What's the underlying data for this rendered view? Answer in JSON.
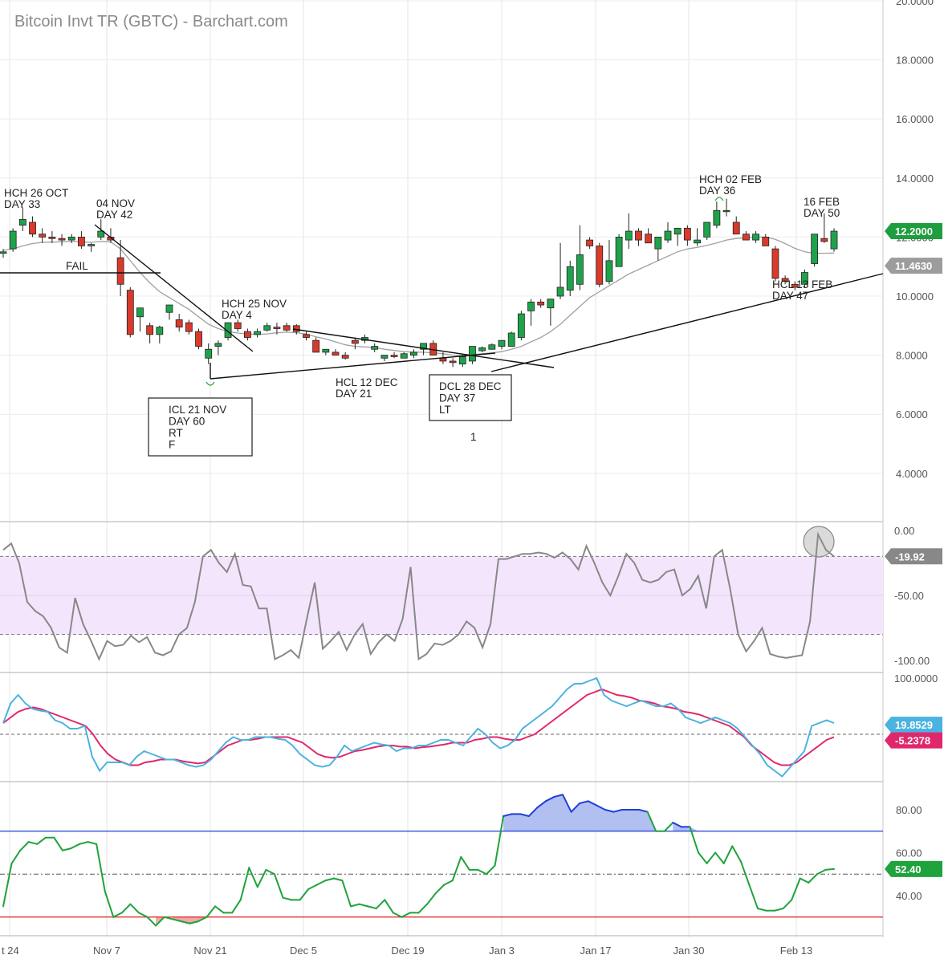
{
  "title": "Bitcoin Invt TR (GBTC) - Barchart.com",
  "chart_data": [
    {
      "type": "candlestick",
      "title": "Bitcoin Invt TR (GBTC) - Barchart.com",
      "x_tick_labels": [
        "t 24",
        "Nov 7",
        "Nov 21",
        "Dec 5",
        "Dec 19",
        "Jan 3",
        "Jan 17",
        "Jan 30",
        "Feb 13"
      ],
      "y_ticks": [
        "4.0000",
        "6.0000",
        "8.0000",
        "10.0000",
        "12.0000",
        "14.0000",
        "16.0000",
        "18.0000",
        "20.0000"
      ],
      "ylim": [
        2.5,
        20
      ],
      "last_price_label": "12.2000",
      "ma_label": "11.4630",
      "colors": {
        "up": "#1fa34a",
        "down": "#d93a2b",
        "ma": "#a0a0a0",
        "last_badge": "#1e9e3e",
        "ma_badge": "#9c9c9c"
      },
      "candles": [
        {
          "o": 11.45,
          "h": 11.6,
          "l": 11.3,
          "c": 11.5
        },
        {
          "o": 11.6,
          "h": 12.3,
          "l": 11.5,
          "c": 12.2
        },
        {
          "o": 12.4,
          "h": 13.0,
          "l": 12.2,
          "c": 12.6
        },
        {
          "o": 12.5,
          "h": 12.7,
          "l": 12.0,
          "c": 12.1
        },
        {
          "o": 12.1,
          "h": 12.3,
          "l": 11.8,
          "c": 12.0
        },
        {
          "o": 12.0,
          "h": 12.2,
          "l": 11.8,
          "c": 11.95
        },
        {
          "o": 11.95,
          "h": 12.1,
          "l": 11.7,
          "c": 11.9
        },
        {
          "o": 11.9,
          "h": 12.1,
          "l": 11.8,
          "c": 12.0
        },
        {
          "o": 12.0,
          "h": 12.2,
          "l": 11.6,
          "c": 11.7
        },
        {
          "o": 11.7,
          "h": 11.8,
          "l": 11.5,
          "c": 11.75
        },
        {
          "o": 12.0,
          "h": 12.6,
          "l": 11.9,
          "c": 12.2
        },
        {
          "o": 12.0,
          "h": 12.3,
          "l": 11.8,
          "c": 11.9
        },
        {
          "o": 11.3,
          "h": 11.9,
          "l": 10.0,
          "c": 10.4
        },
        {
          "o": 10.2,
          "h": 10.3,
          "l": 8.6,
          "c": 8.7
        },
        {
          "o": 9.3,
          "h": 9.6,
          "l": 8.8,
          "c": 9.6
        },
        {
          "o": 9.0,
          "h": 9.1,
          "l": 8.4,
          "c": 8.7
        },
        {
          "o": 8.7,
          "h": 9.0,
          "l": 8.4,
          "c": 8.95
        },
        {
          "o": 9.45,
          "h": 9.7,
          "l": 9.2,
          "c": 9.7
        },
        {
          "o": 9.2,
          "h": 9.4,
          "l": 8.8,
          "c": 8.95
        },
        {
          "o": 9.1,
          "h": 9.2,
          "l": 8.7,
          "c": 8.8
        },
        {
          "o": 8.8,
          "h": 8.9,
          "l": 8.2,
          "c": 8.3
        },
        {
          "o": 7.9,
          "h": 8.4,
          "l": 7.7,
          "c": 8.2
        },
        {
          "o": 8.3,
          "h": 8.5,
          "l": 8.0,
          "c": 8.4
        },
        {
          "o": 8.6,
          "h": 9.1,
          "l": 8.5,
          "c": 9.1
        },
        {
          "o": 9.1,
          "h": 9.2,
          "l": 8.8,
          "c": 8.9
        },
        {
          "o": 8.8,
          "h": 8.9,
          "l": 8.5,
          "c": 8.6
        },
        {
          "o": 8.7,
          "h": 8.9,
          "l": 8.6,
          "c": 8.8
        },
        {
          "o": 8.85,
          "h": 9.1,
          "l": 8.8,
          "c": 9.0
        },
        {
          "o": 8.95,
          "h": 9.1,
          "l": 8.7,
          "c": 8.9
        },
        {
          "o": 9.0,
          "h": 9.1,
          "l": 8.8,
          "c": 8.85
        },
        {
          "o": 9.0,
          "h": 9.05,
          "l": 8.7,
          "c": 8.8
        },
        {
          "o": 8.7,
          "h": 8.8,
          "l": 8.5,
          "c": 8.6
        },
        {
          "o": 8.5,
          "h": 8.6,
          "l": 8.1,
          "c": 8.1
        },
        {
          "o": 8.1,
          "h": 8.2,
          "l": 8.0,
          "c": 8.2
        },
        {
          "o": 8.1,
          "h": 8.2,
          "l": 8.0,
          "c": 8.0
        },
        {
          "o": 8.0,
          "h": 8.1,
          "l": 7.85,
          "c": 7.9
        },
        {
          "o": 8.5,
          "h": 8.6,
          "l": 8.2,
          "c": 8.4
        },
        {
          "o": 8.5,
          "h": 8.7,
          "l": 8.4,
          "c": 8.6
        },
        {
          "o": 8.2,
          "h": 8.4,
          "l": 8.1,
          "c": 8.3
        },
        {
          "o": 7.9,
          "h": 8.0,
          "l": 7.8,
          "c": 8.0
        },
        {
          "o": 8.0,
          "h": 8.1,
          "l": 7.9,
          "c": 7.95
        },
        {
          "o": 7.9,
          "h": 8.1,
          "l": 7.9,
          "c": 8.05
        },
        {
          "o": 8.0,
          "h": 8.2,
          "l": 7.9,
          "c": 8.1
        },
        {
          "o": 8.2,
          "h": 8.4,
          "l": 8.0,
          "c": 8.4
        },
        {
          "o": 8.4,
          "h": 8.5,
          "l": 8.0,
          "c": 8.0
        },
        {
          "o": 7.9,
          "h": 8.1,
          "l": 7.7,
          "c": 7.8
        },
        {
          "o": 7.8,
          "h": 7.9,
          "l": 7.6,
          "c": 7.75
        },
        {
          "o": 7.7,
          "h": 8.0,
          "l": 7.6,
          "c": 7.95
        },
        {
          "o": 7.8,
          "h": 8.3,
          "l": 7.7,
          "c": 8.3
        },
        {
          "o": 8.15,
          "h": 8.3,
          "l": 8.1,
          "c": 8.25
        },
        {
          "o": 8.2,
          "h": 8.4,
          "l": 8.2,
          "c": 8.35
        },
        {
          "o": 8.3,
          "h": 8.5,
          "l": 8.2,
          "c": 8.5
        },
        {
          "o": 8.3,
          "h": 8.8,
          "l": 8.3,
          "c": 8.75
        },
        {
          "o": 8.6,
          "h": 9.5,
          "l": 8.5,
          "c": 9.4
        },
        {
          "o": 9.5,
          "h": 9.9,
          "l": 9.0,
          "c": 9.8
        },
        {
          "o": 9.8,
          "h": 9.9,
          "l": 9.6,
          "c": 9.7
        },
        {
          "o": 9.6,
          "h": 9.9,
          "l": 9.0,
          "c": 9.9
        },
        {
          "o": 10.0,
          "h": 11.8,
          "l": 9.9,
          "c": 10.3
        },
        {
          "o": 10.2,
          "h": 11.2,
          "l": 10.0,
          "c": 11.0
        },
        {
          "o": 10.4,
          "h": 12.4,
          "l": 10.2,
          "c": 11.4
        },
        {
          "o": 11.9,
          "h": 12.0,
          "l": 11.6,
          "c": 11.7
        },
        {
          "o": 11.7,
          "h": 11.8,
          "l": 10.3,
          "c": 10.4
        },
        {
          "o": 10.5,
          "h": 11.9,
          "l": 10.4,
          "c": 11.2
        },
        {
          "o": 11.0,
          "h": 12.1,
          "l": 11.0,
          "c": 12.0
        },
        {
          "o": 11.9,
          "h": 12.8,
          "l": 11.6,
          "c": 12.2
        },
        {
          "o": 12.2,
          "h": 12.3,
          "l": 11.7,
          "c": 11.9
        },
        {
          "o": 12.1,
          "h": 12.3,
          "l": 11.8,
          "c": 11.8
        },
        {
          "o": 11.6,
          "h": 12.0,
          "l": 11.2,
          "c": 12.0
        },
        {
          "o": 11.9,
          "h": 12.5,
          "l": 11.8,
          "c": 12.2
        },
        {
          "o": 12.1,
          "h": 12.3,
          "l": 11.7,
          "c": 12.3
        },
        {
          "o": 12.3,
          "h": 12.4,
          "l": 11.7,
          "c": 11.9
        },
        {
          "o": 11.8,
          "h": 12.3,
          "l": 11.7,
          "c": 11.9
        },
        {
          "o": 12.0,
          "h": 12.5,
          "l": 11.9,
          "c": 12.5
        },
        {
          "o": 12.4,
          "h": 13.2,
          "l": 12.3,
          "c": 12.9
        },
        {
          "o": 12.9,
          "h": 13.3,
          "l": 12.7,
          "c": 12.9
        },
        {
          "o": 12.5,
          "h": 12.7,
          "l": 12.1,
          "c": 12.1
        },
        {
          "o": 12.1,
          "h": 12.2,
          "l": 11.9,
          "c": 11.9
        },
        {
          "o": 11.9,
          "h": 12.2,
          "l": 11.8,
          "c": 12.1
        },
        {
          "o": 12.0,
          "h": 12.1,
          "l": 11.7,
          "c": 11.7
        },
        {
          "o": 11.6,
          "h": 11.7,
          "l": 10.5,
          "c": 10.6
        },
        {
          "o": 10.6,
          "h": 10.7,
          "l": 10.4,
          "c": 10.5
        },
        {
          "o": 10.4,
          "h": 10.5,
          "l": 10.2,
          "c": 10.3
        },
        {
          "o": 10.4,
          "h": 10.9,
          "l": 10.3,
          "c": 10.8
        },
        {
          "o": 11.1,
          "h": 12.1,
          "l": 11.0,
          "c": 12.1
        },
        {
          "o": 11.95,
          "h": 12.8,
          "l": 11.8,
          "c": 11.85
        },
        {
          "o": 11.6,
          "h": 12.3,
          "l": 11.5,
          "c": 12.2
        }
      ],
      "ma": [
        11.55,
        11.6,
        11.7,
        11.78,
        11.82,
        11.83,
        11.84,
        11.85,
        11.84,
        11.82,
        11.85,
        11.84,
        11.6,
        11.2,
        10.8,
        10.45,
        10.15,
        9.95,
        9.75,
        9.55,
        9.3,
        9.05,
        8.9,
        8.8,
        8.75,
        8.72,
        8.7,
        8.72,
        8.76,
        8.78,
        8.76,
        8.72,
        8.62,
        8.55,
        8.45,
        8.35,
        8.3,
        8.28,
        8.26,
        8.2,
        8.16,
        8.12,
        8.1,
        8.1,
        8.08,
        8.05,
        8.0,
        8.0,
        8.02,
        8.05,
        8.08,
        8.12,
        8.2,
        8.3,
        8.45,
        8.6,
        8.8,
        9.05,
        9.35,
        9.65,
        9.95,
        10.15,
        10.35,
        10.55,
        10.75,
        10.9,
        11.05,
        11.2,
        11.35,
        11.5,
        11.6,
        11.65,
        11.72,
        11.8,
        11.9,
        11.95,
        11.98,
        12.0,
        12.0,
        11.92,
        11.78,
        11.62,
        11.5,
        11.45,
        11.45,
        11.46
      ],
      "annotations": [
        {
          "id": "hch-26-oct",
          "lines": [
            "HCH 26 OCT",
            "DAY 33"
          ]
        },
        {
          "id": "04-nov",
          "lines": [
            "04 NOV",
            "DAY 42"
          ]
        },
        {
          "id": "fail",
          "lines": [
            "FAIL"
          ]
        },
        {
          "id": "hch-25-nov",
          "lines": [
            "HCH 25 NOV",
            "DAY 4"
          ]
        },
        {
          "id": "icl-21-nov",
          "lines": [
            "ICL 21 NOV",
            "DAY 60",
            "RT",
            "F"
          ]
        },
        {
          "id": "hcl-12-dec",
          "lines": [
            "HCL 12 DEC",
            "DAY 21"
          ]
        },
        {
          "id": "dcl-28-dec",
          "lines": [
            "DCL 28 DEC",
            "DAY 37",
            "LT"
          ]
        },
        {
          "id": "one",
          "lines": [
            "1"
          ]
        },
        {
          "id": "hch-02-feb",
          "lines": [
            "HCH 02 FEB",
            "DAY 36"
          ]
        },
        {
          "id": "16-feb",
          "lines": [
            "16 FEB",
            "DAY 50"
          ]
        },
        {
          "id": "hcl-13-feb",
          "lines": [
            "HCL 13 FEB",
            "DAY 47"
          ]
        }
      ]
    },
    {
      "type": "line",
      "name": "williams-r",
      "y_ticks": [
        "0.00",
        "-50.00",
        "-100.00"
      ],
      "ylim": [
        -103,
        3
      ],
      "band": [
        -80,
        -20
      ],
      "last_label": "-19.92",
      "colors": {
        "line": "#888888",
        "band": "#f3e6fc",
        "badge": "#888888"
      },
      "values": [
        -15,
        -10,
        -25,
        -55,
        -62,
        -66,
        -75,
        -90,
        -94,
        -52,
        -72,
        -85,
        -99,
        -85,
        -89,
        -88,
        -81,
        -86,
        -82,
        -94,
        -96,
        -93,
        -80,
        -75,
        -55,
        -20,
        -15,
        -25,
        -32,
        -18,
        -42,
        -43,
        -60,
        -60,
        -99,
        -96,
        -92,
        -98,
        -68,
        -40,
        -91,
        -85,
        -78,
        -92,
        -80,
        -72,
        -95,
        -86,
        -80,
        -85,
        -68,
        -28,
        -99,
        -95,
        -87,
        -88,
        -85,
        -80,
        -70,
        -75,
        -90,
        -72,
        -22,
        -22,
        -20,
        -18,
        -18,
        -17,
        -18,
        -21,
        -17,
        -22,
        -30,
        -12,
        -25,
        -40,
        -50,
        -35,
        -18,
        -25,
        -38,
        -40,
        -38,
        -32,
        -30,
        -50,
        -45,
        -35,
        -60,
        -20,
        -15,
        -45,
        -80,
        -93,
        -85,
        -75,
        -95,
        -97,
        -98,
        -97,
        -96,
        -70,
        -3,
        -15,
        -20
      ]
    },
    {
      "type": "line",
      "name": "stochastic",
      "y_ticks": [
        "100.0000"
      ],
      "ylim": [
        -110,
        110
      ],
      "last_labels": [
        "19.8529",
        "-5.2378"
      ],
      "colors": {
        "fast": "#4ab3e0",
        "slow": "#e0276c",
        "fast_badge": "#4ab3e0",
        "slow_badge": "#e0276c"
      },
      "fast": [
        20,
        55,
        70,
        55,
        45,
        42,
        40,
        25,
        20,
        10,
        10,
        15,
        -40,
        -65,
        -50,
        -50,
        -50,
        -55,
        -40,
        -30,
        -35,
        -40,
        -45,
        -45,
        -50,
        -55,
        -58,
        -55,
        -45,
        -30,
        -15,
        -5,
        -10,
        -10,
        -5,
        -5,
        -5,
        -8,
        -10,
        -20,
        -35,
        -45,
        -55,
        -58,
        -55,
        -40,
        -20,
        -30,
        -25,
        -20,
        -15,
        -18,
        -20,
        -30,
        -25,
        -25,
        -20,
        -20,
        -15,
        -10,
        -10,
        -15,
        -20,
        -5,
        10,
        0,
        -15,
        -25,
        -20,
        -10,
        10,
        20,
        30,
        40,
        50,
        65,
        80,
        90,
        90,
        95,
        100,
        70,
        60,
        55,
        50,
        55,
        60,
        55,
        50,
        50,
        55,
        45,
        30,
        25,
        20,
        25,
        30,
        25,
        20,
        10,
        -5,
        -20,
        -35,
        -55,
        -65,
        -75,
        -60,
        -45,
        -30,
        15,
        20,
        25,
        20
      ],
      "slow": [
        20,
        30,
        40,
        45,
        48,
        45,
        40,
        35,
        30,
        25,
        20,
        15,
        0,
        -20,
        -35,
        -45,
        -50,
        -55,
        -55,
        -50,
        -48,
        -45,
        -45,
        -45,
        -48,
        -50,
        -52,
        -50,
        -40,
        -30,
        -20,
        -15,
        -10,
        -10,
        -8,
        -5,
        -5,
        -5,
        -5,
        -10,
        -15,
        -25,
        -35,
        -40,
        -42,
        -40,
        -35,
        -30,
        -28,
        -25,
        -22,
        -20,
        -20,
        -22,
        -22,
        -25,
        -23,
        -22,
        -20,
        -18,
        -15,
        -15,
        -15,
        -10,
        -8,
        -5,
        -5,
        -8,
        -10,
        -10,
        -5,
        0,
        10,
        20,
        30,
        40,
        50,
        60,
        70,
        75,
        80,
        75,
        70,
        68,
        65,
        60,
        58,
        55,
        50,
        48,
        45,
        40,
        38,
        35,
        30,
        25,
        20,
        15,
        5,
        -5,
        -20,
        -30,
        -40,
        -50,
        -55,
        -55,
        -50,
        -40,
        -30,
        -20,
        -10,
        -5
      ],
      "mid_line": 0
    },
    {
      "type": "line",
      "name": "rsi",
      "y_ticks": [
        "80.00",
        "60.00",
        "40.00"
      ],
      "ylim": [
        21,
        94
      ],
      "levels": {
        "upper": 70,
        "middle": 50,
        "lower": 30
      },
      "last_label": "52.40",
      "colors": {
        "line": "#1fa33c",
        "upper": "#1f3fd6",
        "lower": "#e02020",
        "upper_fill": "#a8b8f0",
        "lower_fill": "#f0a0a0",
        "badge": "#1fa33c"
      },
      "values": [
        35,
        55,
        61,
        65,
        64,
        67,
        67,
        61,
        62,
        64,
        65,
        64,
        42,
        30,
        32,
        36,
        32,
        30,
        26,
        30,
        29,
        28,
        27,
        28,
        30,
        35,
        32,
        32,
        38,
        53,
        44,
        52,
        50,
        39,
        38,
        38,
        43,
        45,
        47,
        48,
        47,
        35,
        36,
        35,
        34,
        38,
        32,
        30,
        32,
        32,
        36,
        41,
        45,
        47,
        58,
        52,
        52,
        50,
        54,
        77,
        78,
        78,
        77,
        81,
        84,
        86,
        87,
        79,
        83,
        84,
        82,
        80,
        79,
        80,
        80,
        80,
        79,
        70,
        70,
        74,
        72,
        72,
        60,
        55,
        60,
        55,
        63,
        56,
        45,
        34,
        33,
        33,
        34,
        38,
        48,
        46,
        50,
        52,
        52.4
      ]
    }
  ]
}
